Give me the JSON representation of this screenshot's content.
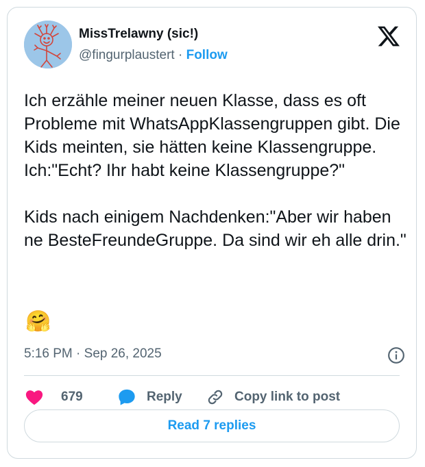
{
  "tweet": {
    "author": {
      "name": "MissTrelawny (sic!)",
      "handle": "@fingurplaustert",
      "separator": "·",
      "follow_label": "Follow",
      "avatar_icon": "hand-drawn-smiley-avatar-icon"
    },
    "platform_icon": "x-logo-icon",
    "text": "Ich erzähle meiner neuen Klasse, dass es oft Probleme mit WhatsAppKlassengruppen gibt. Die Kids meinten, sie hätten keine Klassengruppe. Ich:\"Echt? Ihr habt keine Klassengruppe?\"\n\nKids nach einigem Nachdenken:\"Aber wir haben ne BesteFreundeGruppe. Da sind wir eh alle drin.\"",
    "emoji": "🤗",
    "timestamp": "5:16 PM · Sep 26, 2025",
    "info_icon": "info-circle-icon"
  },
  "actions": {
    "like_count": "679",
    "reply_label": "Reply",
    "copy_link_label": "Copy link to post",
    "like_icon": "heart-icon",
    "reply_icon": "speech-bubble-icon",
    "copy_icon": "link-icon"
  },
  "read_replies_label": "Read 7 replies",
  "colors": {
    "accent": "#1d9bf0",
    "like": "#f91880",
    "text": "#0f1419",
    "secondary": "#536471",
    "border": "#cfd9de"
  }
}
